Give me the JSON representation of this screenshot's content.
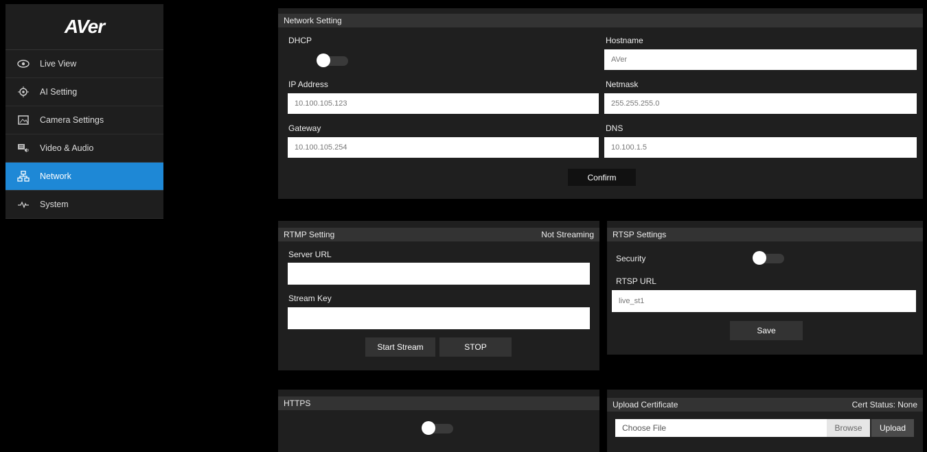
{
  "sidebar": {
    "logo": "AVer",
    "items": [
      {
        "label": "Live View",
        "icon": "eye-icon"
      },
      {
        "label": "AI Setting",
        "icon": "target-icon"
      },
      {
        "label": "Camera Settings",
        "icon": "image-icon"
      },
      {
        "label": "Video & Audio",
        "icon": "video-audio-icon"
      },
      {
        "label": "Network",
        "icon": "network-icon",
        "active": true
      },
      {
        "label": "System",
        "icon": "pulse-icon"
      }
    ],
    "active_color": "#1e88d6"
  },
  "network_setting": {
    "title": "Network Setting",
    "dhcp_label": "DHCP",
    "dhcp_enabled": false,
    "hostname_label": "Hostname",
    "hostname_value": "AVer",
    "ip_label": "IP Address",
    "ip_value": "10.100.105.123",
    "netmask_label": "Netmask",
    "netmask_value": "255.255.255.0",
    "gateway_label": "Gateway",
    "gateway_value": "10.100.105.254",
    "dns_label": "DNS",
    "dns_value": "10.100.1.5",
    "confirm_label": "Confirm"
  },
  "rtmp_setting": {
    "title": "RTMP Setting",
    "status": "Not Streaming",
    "server_url_label": "Server URL",
    "server_url_value": "",
    "stream_key_label": "Stream Key",
    "stream_key_value": "",
    "start_label": "Start Stream",
    "stop_label": "STOP"
  },
  "rtsp_settings": {
    "title": "RTSP Settings",
    "security_label": "Security",
    "security_enabled": false,
    "rtsp_url_label": "RTSP URL",
    "rtsp_url_value": "live_st1",
    "save_label": "Save"
  },
  "https": {
    "title": "HTTPS",
    "enabled": false
  },
  "upload_certificate": {
    "title": "Upload Certificate",
    "status": "Cert Status: None",
    "choose_file_placeholder": "Choose File",
    "browse_label": "Browse",
    "upload_label": "Upload"
  }
}
